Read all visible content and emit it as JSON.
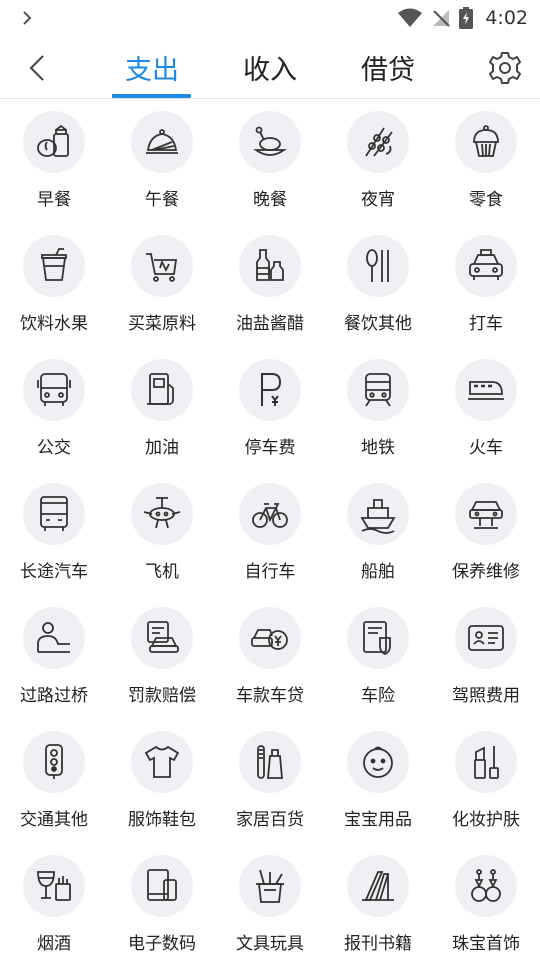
{
  "status_bar": {
    "time": "4:02",
    "chevron_icon": "chevron-right-icon",
    "wifi_icon": "wifi-icon",
    "signal_icon": "no-signal-icon",
    "battery_icon": "battery-charging-icon"
  },
  "nav": {
    "back_icon": "chevron-left-icon",
    "tabs": [
      {
        "label": "支出",
        "active": true
      },
      {
        "label": "收入",
        "active": false
      },
      {
        "label": "借贷",
        "active": false
      }
    ],
    "settings_icon": "gear-icon",
    "accent_color": "#1e88e5"
  },
  "categories": [
    {
      "label": "早餐",
      "icon": "breakfast-icon"
    },
    {
      "label": "午餐",
      "icon": "lunch-icon"
    },
    {
      "label": "晚餐",
      "icon": "dinner-icon"
    },
    {
      "label": "夜宵",
      "icon": "skewer-icon"
    },
    {
      "label": "零食",
      "icon": "cupcake-icon"
    },
    {
      "label": "饮料水果",
      "icon": "drink-cup-icon"
    },
    {
      "label": "买菜原料",
      "icon": "grocery-cart-icon"
    },
    {
      "label": "油盐酱醋",
      "icon": "condiment-bottles-icon"
    },
    {
      "label": "餐饮其他",
      "icon": "spoon-chopsticks-icon"
    },
    {
      "label": "打车",
      "icon": "taxi-icon"
    },
    {
      "label": "公交",
      "icon": "bus-icon"
    },
    {
      "label": "加油",
      "icon": "fuel-pump-icon"
    },
    {
      "label": "停车费",
      "icon": "parking-icon"
    },
    {
      "label": "地铁",
      "icon": "subway-icon"
    },
    {
      "label": "火车",
      "icon": "train-icon"
    },
    {
      "label": "长途汽车",
      "icon": "coach-bus-icon"
    },
    {
      "label": "飞机",
      "icon": "airplane-icon"
    },
    {
      "label": "自行车",
      "icon": "bicycle-icon"
    },
    {
      "label": "船舶",
      "icon": "ship-icon"
    },
    {
      "label": "保养维修",
      "icon": "car-lift-icon"
    },
    {
      "label": "过路过桥",
      "icon": "toll-booth-icon"
    },
    {
      "label": "罚款赔偿",
      "icon": "car-ticket-icon"
    },
    {
      "label": "车款车贷",
      "icon": "car-loan-icon"
    },
    {
      "label": "车险",
      "icon": "car-insurance-icon"
    },
    {
      "label": "驾照费用",
      "icon": "license-card-icon"
    },
    {
      "label": "交通其他",
      "icon": "traffic-light-icon"
    },
    {
      "label": "服饰鞋包",
      "icon": "tshirt-icon"
    },
    {
      "label": "家居百货",
      "icon": "toothbrush-icon"
    },
    {
      "label": "宝宝用品",
      "icon": "baby-face-icon"
    },
    {
      "label": "化妆护肤",
      "icon": "lipstick-icon"
    },
    {
      "label": "烟酒",
      "icon": "wine-cigarette-icon"
    },
    {
      "label": "电子数码",
      "icon": "devices-icon"
    },
    {
      "label": "文具玩具",
      "icon": "pen-holder-icon"
    },
    {
      "label": "报刊书籍",
      "icon": "books-icon"
    },
    {
      "label": "珠宝首饰",
      "icon": "earrings-icon"
    }
  ]
}
